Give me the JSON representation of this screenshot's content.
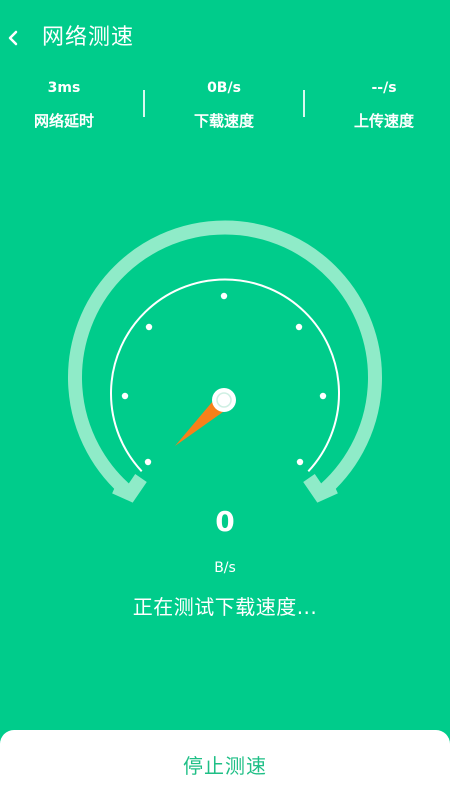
{
  "header": {
    "title": "网络测速",
    "back_icon": "chevron-left-icon"
  },
  "stats": [
    {
      "value": "3ms",
      "label": "网络延时"
    },
    {
      "value": "0B/s",
      "label": "下载速度"
    },
    {
      "value": "--/s",
      "label": "上传速度"
    }
  ],
  "gauge": {
    "speed_value": "0",
    "speed_unit": "B/s",
    "status_text": "正在测试下载速度...",
    "needle_color": "#F7801A",
    "ring_color": "#8FEBC8"
  },
  "actions": {
    "stop_label": "停止测速"
  },
  "colors": {
    "background": "#00CC8B",
    "button_text": "#1FBF86"
  }
}
